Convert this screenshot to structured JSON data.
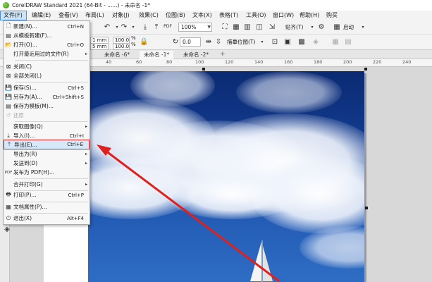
{
  "window": {
    "title": "CorelDRAW Standard 2021 (64-Bit - ......) - 未命名 -1*"
  },
  "menubar": {
    "items": [
      "文件(F)",
      "编辑(E)",
      "查看(V)",
      "布局(L)",
      "对象(J)",
      "效果(C)",
      "位图(B)",
      "文本(X)",
      "表格(T)",
      "工具(O)",
      "窗口(W)",
      "帮助(H)",
      "购买"
    ]
  },
  "toolbar": {
    "zoom_value": "100%",
    "paste_label": "贴齐(T)",
    "launch_label": "启动",
    "snap_label": "描摹位图(T)",
    "size_w": "1 mm",
    "size_h": "5 mm",
    "scale_x": "100.0",
    "scale_y": "100.0",
    "pct_x": "%",
    "pct_y": "%",
    "rotation": "0.0"
  },
  "tabs": {
    "items": [
      "未命名 -6*",
      "未命名 -1*",
      "未命名 -2*"
    ],
    "active_index": 1
  },
  "ruler": {
    "labels": [
      "40",
      "60",
      "80",
      "100",
      "120",
      "140",
      "160",
      "180",
      "200",
      "220",
      "240"
    ]
  },
  "file_menu": {
    "items": [
      {
        "label": "新建(N)...",
        "shortcut": "Ctrl+N",
        "icon": "new-doc-icon",
        "glyph": "🗋"
      },
      {
        "label": "从模板新建(F)...",
        "shortcut": "",
        "icon": "template-icon",
        "glyph": "▤"
      },
      {
        "label": "打开(O)...",
        "shortcut": "Ctrl+O",
        "icon": "open-folder-icon",
        "glyph": "📂"
      },
      {
        "label": "打开最近用过的文件(R)",
        "shortcut": "",
        "icon": "",
        "glyph": ""
      },
      {
        "label": "关闭(C)",
        "shortcut": "",
        "icon": "close-doc-icon",
        "glyph": "⊠"
      },
      {
        "label": "全部关闭(L)",
        "shortcut": "",
        "icon": "close-all-icon",
        "glyph": "⊠"
      },
      {
        "label": "保存(S)...",
        "shortcut": "Ctrl+S",
        "icon": "save-icon",
        "glyph": "💾"
      },
      {
        "label": "另存为(A)...",
        "shortcut": "Ctrl+Shift+S",
        "icon": "save-as-icon",
        "glyph": "💾"
      },
      {
        "label": "保存为模板(M)...",
        "shortcut": "",
        "icon": "save-template-icon",
        "glyph": "▤"
      },
      {
        "label": "还原",
        "shortcut": "",
        "icon": "revert-icon",
        "glyph": "↺"
      },
      {
        "label": "获取图像(Q)",
        "shortcut": "",
        "icon": "",
        "glyph": ""
      },
      {
        "label": "导入(I)...",
        "shortcut": "Ctrl+I",
        "icon": "import-icon",
        "glyph": "⤓"
      },
      {
        "label": "导出(E)...",
        "shortcut": "Ctrl+E",
        "icon": "export-icon",
        "glyph": "⤒"
      },
      {
        "label": "导出为(R)",
        "shortcut": "",
        "icon": "",
        "glyph": ""
      },
      {
        "label": "发送到(D)",
        "shortcut": "",
        "icon": "",
        "glyph": ""
      },
      {
        "label": "发布为 PDF(H)...",
        "shortcut": "",
        "icon": "pdf-icon",
        "glyph": "PDF"
      },
      {
        "label": "合并打印(G)",
        "shortcut": "",
        "icon": "",
        "glyph": ""
      },
      {
        "label": "打印(P)...",
        "shortcut": "Ctrl+P",
        "icon": "print-icon",
        "glyph": "🖶"
      },
      {
        "label": "文档属性(P)...",
        "shortcut": "",
        "icon": "doc-properties-icon",
        "glyph": "▦"
      },
      {
        "label": "退出(X)",
        "shortcut": "Alt+F4",
        "icon": "exit-icon",
        "glyph": "⏻"
      }
    ]
  },
  "colors": {
    "highlight_border": "#e0201c",
    "annotation_arrow": "#e0201c",
    "menu_active": "#cce4f7"
  }
}
